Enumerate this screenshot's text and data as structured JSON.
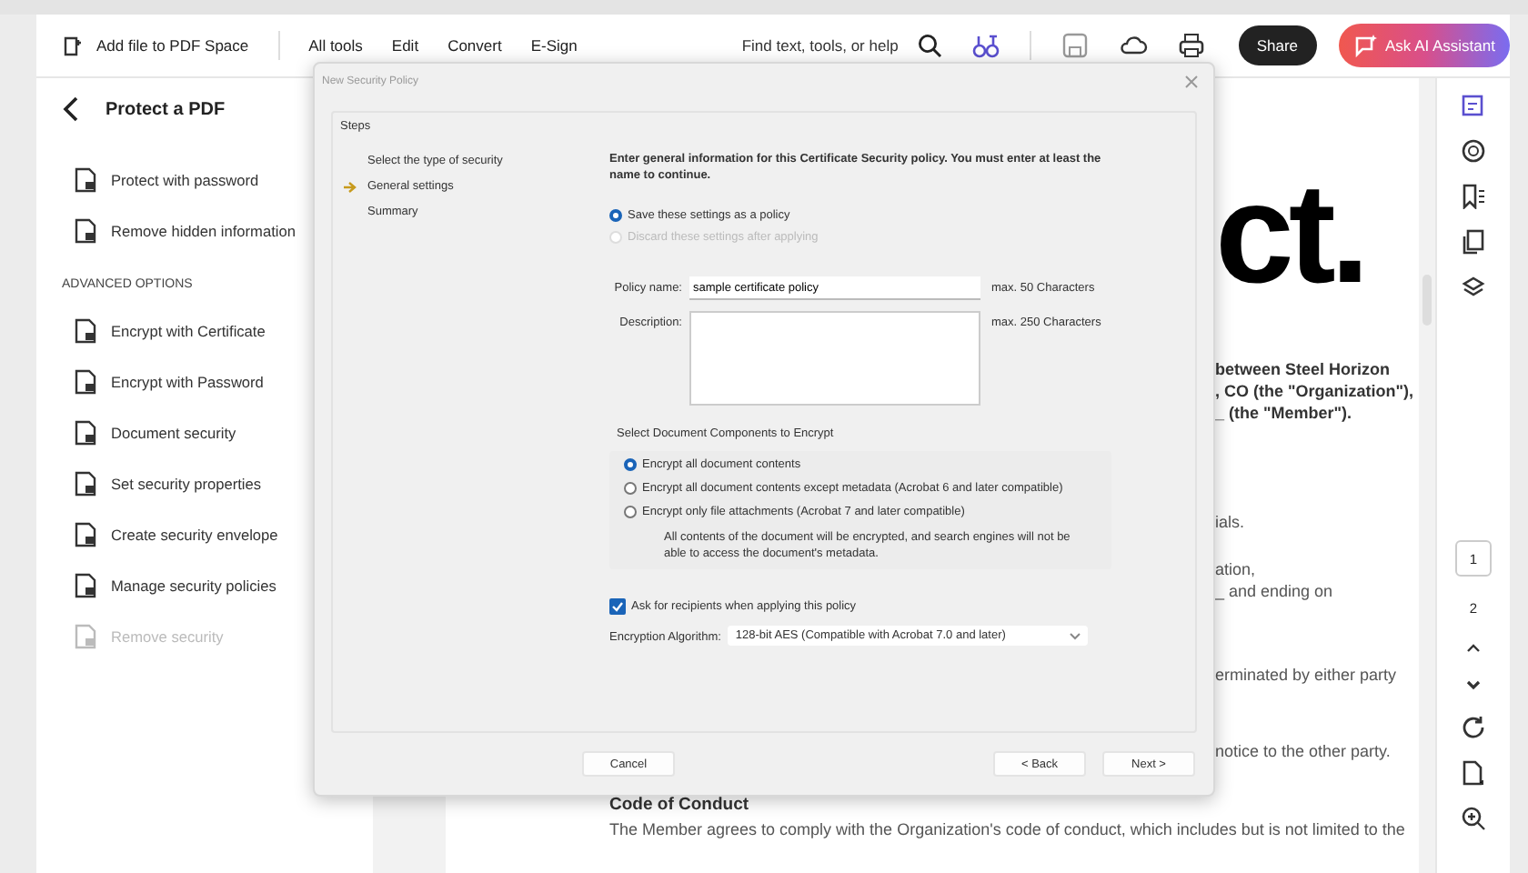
{
  "toolbar": {
    "add_file": "Add file to PDF Space",
    "menu": [
      {
        "label": "All tools"
      },
      {
        "label": "Edit"
      },
      {
        "label": "Convert"
      },
      {
        "label": "E-Sign"
      }
    ],
    "search_placeholder": "Find text, tools, or help",
    "share": "Share",
    "ai_assistant": "Ask AI Assistant"
  },
  "sidebar": {
    "title": "Protect a PDF",
    "items": [
      {
        "label": "Protect with password",
        "disabled": false
      },
      {
        "label": "Remove hidden information",
        "disabled": false
      }
    ],
    "section": "ADVANCED OPTIONS",
    "advanced_items": [
      {
        "label": "Encrypt with Certificate",
        "disabled": false
      },
      {
        "label": "Encrypt with Password",
        "disabled": false
      },
      {
        "label": "Document security",
        "disabled": false
      },
      {
        "label": "Set security properties",
        "disabled": false
      },
      {
        "label": "Create security envelope",
        "disabled": false
      },
      {
        "label": "Manage security policies",
        "disabled": false
      },
      {
        "label": "Remove security",
        "disabled": true
      }
    ]
  },
  "document": {
    "heading": "ct.",
    "paragraphs": [
      {
        "bold": true,
        "lines": [
          "between Steel Horizon",
          ", CO (the \"Organization\"),",
          "_ (the \"Member\")."
        ]
      },
      {
        "bold": false,
        "lines": [
          "ials."
        ]
      },
      {
        "bold": false,
        "lines": [
          "ation,",
          "_ and ending on"
        ]
      },
      {
        "bold": false,
        "lines": [
          "erminated by either party"
        ]
      },
      {
        "bold": false,
        "lines": [
          "notice to the other party."
        ]
      }
    ],
    "section_title": "Code of Conduct",
    "section_text": "The Member agrees to comply with the Organization's code of conduct, which includes but is not limited to the"
  },
  "rail": {
    "pages": [
      {
        "label": "1",
        "selected": true
      },
      {
        "label": "2",
        "selected": false
      }
    ]
  },
  "dialog": {
    "title": "New Security Policy",
    "steps_heading": "Steps",
    "steps": [
      {
        "label": "Select the type of security",
        "selected": false
      },
      {
        "label": "General settings",
        "selected": true
      },
      {
        "label": "Summary",
        "selected": false
      }
    ],
    "intro": "Enter general information for this Certificate Security policy. You must enter at least the name to continue.",
    "save_options": [
      {
        "label": "Save these settings as a policy",
        "selected": true,
        "disabled": false
      },
      {
        "label": "Discard these settings after applying",
        "selected": false,
        "disabled": true
      }
    ],
    "policy_name": {
      "label": "Policy name:",
      "value": "sample certificate policy",
      "hint": "max. 50 Characters"
    },
    "description": {
      "label": "Description:",
      "hint": "max. 250 Characters"
    },
    "components": {
      "title": "Select Document Components to Encrypt",
      "options": [
        {
          "label": "Encrypt all document contents",
          "selected": true
        },
        {
          "label": "Encrypt all document contents except metadata (Acrobat 6 and later compatible)",
          "selected": false
        },
        {
          "label": "Encrypt only file attachments (Acrobat 7 and later compatible)",
          "selected": false
        }
      ],
      "note": "All contents of the document will be encrypted, and search engines will not be able to access the document's metadata."
    },
    "ask_recipients": {
      "label": "Ask for recipients when applying this policy",
      "checked": true
    },
    "algorithm": {
      "label": "Encryption Algorithm:",
      "value": "128-bit AES (Compatible with Acrobat 7.0 and later)"
    },
    "buttons": {
      "cancel": "Cancel",
      "back": "< Back",
      "next": "Next >"
    }
  }
}
